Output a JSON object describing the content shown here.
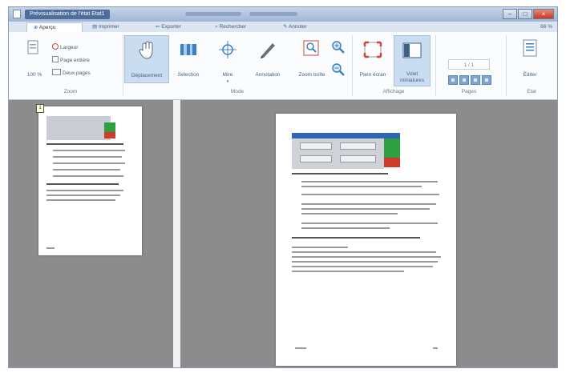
{
  "window": {
    "title": "Prévisualisation de l'état Etat1"
  },
  "tabs": [
    {
      "label": "Aperçu",
      "icon": "preview-icon"
    },
    {
      "label": "Imprimer",
      "icon": "printer-icon"
    },
    {
      "label": "Exporter",
      "icon": "export-icon"
    },
    {
      "label": "Rechercher",
      "icon": "search-icon"
    },
    {
      "label": "Annoter",
      "icon": "pencil-icon"
    }
  ],
  "zoom_level": "66 %",
  "ribbon": {
    "zoom": {
      "percent": "100 %",
      "largeur": "Largeur",
      "page_entiere": "Page entière",
      "deux_pages": "Deux pages",
      "group": "Zoom"
    },
    "mode": {
      "deplacement": "Déplacement",
      "selection": "Sélection",
      "mire": "Mire",
      "annotation": "Annotation",
      "zoom_boite": "Zoom boîte",
      "group": "Mode"
    },
    "affichage": {
      "plein_ecran": "Plein écran",
      "volet_miniatures": "Volet miniatures",
      "group": "Affichage"
    },
    "pages": {
      "current": "1 / 1",
      "group": "Pages"
    },
    "etat": {
      "editer": "Éditer",
      "group": "Etat"
    }
  },
  "thumbnail": {
    "number": "1"
  },
  "colors": {
    "accent": "#2f67b3",
    "highlight": "#c9dcf0",
    "workspace": "#8c8c8c"
  }
}
